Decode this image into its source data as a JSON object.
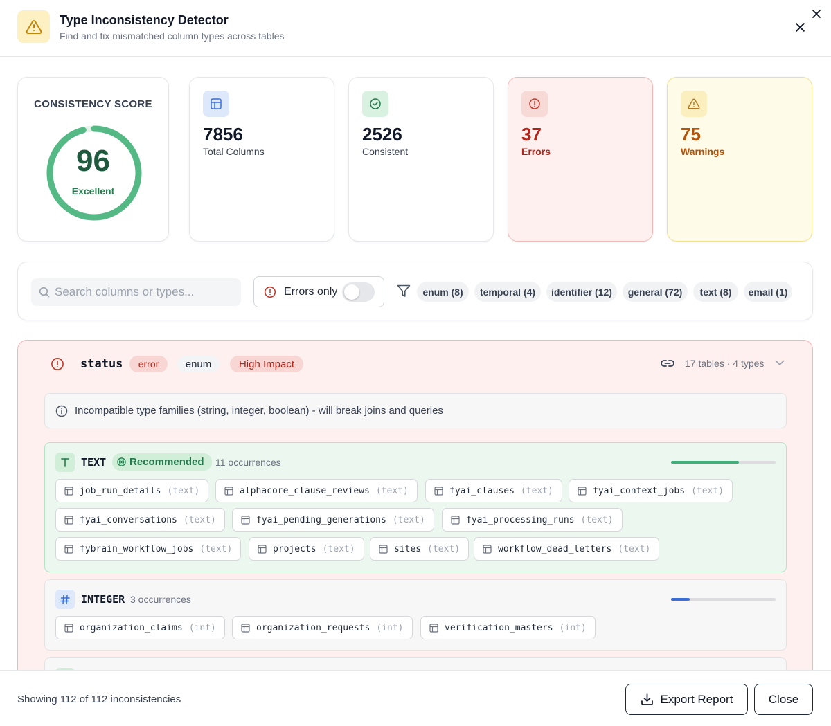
{
  "header": {
    "title": "Type Inconsistency Detector",
    "subtitle": "Find and fix mismatched column types across tables",
    "icon": "warning-triangle-icon"
  },
  "score": {
    "label": "CONSISTENCY SCORE",
    "value": "96",
    "rating": "Excellent",
    "percent": 96,
    "color": "#55b985"
  },
  "stats": {
    "total": {
      "value": "7856",
      "label": "Total Columns",
      "icon": "table-icon"
    },
    "consistent": {
      "value": "2526",
      "label": "Consistent",
      "icon": "check-circle-icon"
    },
    "errors": {
      "value": "37",
      "label": "Errors",
      "icon": "alert-circle-icon",
      "color": "#b42318"
    },
    "warnings": {
      "value": "75",
      "label": "Warnings",
      "icon": "warning-triangle-icon",
      "color": "#b45309"
    }
  },
  "filters": {
    "search_placeholder": "Search columns or types...",
    "errors_only_label": "Errors only",
    "errors_only_enabled": false,
    "chips": [
      "enum (8)",
      "temporal (4)",
      "identifier (12)",
      "general (72)",
      "text (8)",
      "email (1)"
    ]
  },
  "issue": {
    "column": "status",
    "severity": "error",
    "category": "enum",
    "impact": "High Impact",
    "meta": "17 tables · 4 types",
    "message": "Incompatible type families (string, integer, boolean) - will break joins and queries",
    "groups": [
      {
        "name": "TEXT",
        "icon": "text-type-icon",
        "recommended_label": "Recommended",
        "occurrences": "11 occurrences",
        "share": 0.65,
        "tables": [
          {
            "name": "job_run_details",
            "type": "(text)"
          },
          {
            "name": "alphacore_clause_reviews",
            "type": "(text)"
          },
          {
            "name": "fyai_clauses",
            "type": "(text)"
          },
          {
            "name": "fyai_context_jobs",
            "type": "(text)"
          },
          {
            "name": "fyai_conversations",
            "type": "(text)"
          },
          {
            "name": "fyai_pending_generations",
            "type": "(text)"
          },
          {
            "name": "fyai_processing_runs",
            "type": "(text)"
          },
          {
            "name": "fybrain_workflow_jobs",
            "type": "(text)"
          },
          {
            "name": "projects",
            "type": "(text)"
          },
          {
            "name": "sites",
            "type": "(text)"
          },
          {
            "name": "workflow_dead_letters",
            "type": "(text)"
          }
        ]
      },
      {
        "name": "INTEGER",
        "icon": "hash-icon",
        "occurrences": "3 occurrences",
        "share": 0.18,
        "tables": [
          {
            "name": "organization_claims",
            "type": "(int)"
          },
          {
            "name": "organization_requests",
            "type": "(int)"
          },
          {
            "name": "verification_masters",
            "type": "(int)"
          }
        ]
      }
    ]
  },
  "footer": {
    "summary": "Showing 112 of 112 inconsistencies",
    "export_label": "Export Report",
    "close_label": "Close"
  }
}
